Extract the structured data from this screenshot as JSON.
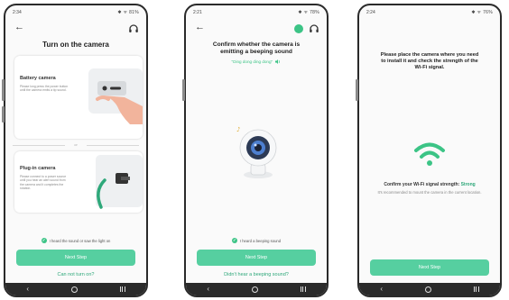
{
  "screens": [
    {
      "status_time": "2:34",
      "status_right": "✱ ᯤ 81%",
      "title": "Turn on the camera",
      "options": [
        {
          "title": "Battery camera",
          "desc": "Please long press the power button until the camera emits a tip sound."
        },
        {
          "title": "Plug-in camera",
          "desc": "Please connect to a power source until you hear an alert sound from the camera and it completes the rotation."
        }
      ],
      "or_text": "or",
      "check_text": "I heard the sound or saw the light on",
      "button": "Next Step",
      "link": "Can not turn on?"
    },
    {
      "status_time": "2:21",
      "status_right": "✱ ᯤ 78%",
      "title_line1": "Confirm whether the camera is",
      "title_line2": "emitting a beeping sound",
      "sound_text": "\"Ding dong ding dong\"",
      "check_text": "I heard a beeping sound",
      "button": "Next Step",
      "link": "Didn't hear a beeping sound?"
    },
    {
      "status_time": "2:24",
      "status_right": "✱ ᯤ 76%",
      "title_line1": "Please place the camera where you need",
      "title_line2": "to install it and check the strength of the",
      "title_line3": "Wi-Fi signal.",
      "signal_label": "Confirm your Wi-Fi signal strength:",
      "signal_value": "Strong",
      "signal_note": "It's recommended to mount the camera in the current location.",
      "button": "Next Step"
    }
  ],
  "colors": {
    "accent": "#3cc486",
    "button": "#56cfa0",
    "link": "#2ea87a"
  },
  "icons": [
    "back-arrow-icon",
    "headset-icon",
    "check-icon",
    "speaker-icon",
    "wifi-icon",
    "camera-icon"
  ]
}
